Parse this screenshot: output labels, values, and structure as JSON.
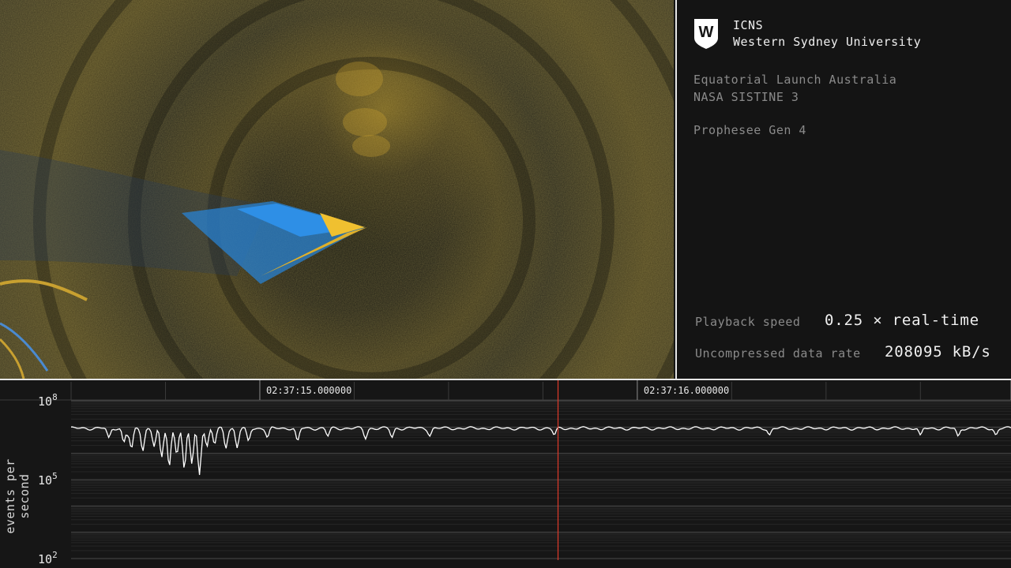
{
  "panel": {
    "logo_letter": "W",
    "org_line1": "ICNS",
    "org_line2": "Western Sydney University",
    "location": "Equatorial Launch Australia",
    "mission": "NASA SISTINE 3",
    "sensor": "Prophesee Gen 4",
    "playback_label": "Playback speed",
    "playback_value": "0.25 × real-time",
    "datarate_label": "Uncompressed data rate",
    "datarate_value": "208095 kB/s"
  },
  "chart_data": {
    "type": "line",
    "title": "",
    "ylabel": "events per second",
    "xlabel": "",
    "yscale": "log",
    "ylim": [
      100,
      100000000
    ],
    "y_ticks": [
      {
        "base": "10",
        "exp": "8",
        "value": 100000000
      },
      {
        "base": "10",
        "exp": "5",
        "value": 100000
      },
      {
        "base": "10",
        "exp": "2",
        "value": 100
      }
    ],
    "x_ticks": [
      "02:37:15.000000",
      "02:37:16.000000",
      "02:"
    ],
    "x_tick_seconds": [
      15.0,
      16.0,
      16.99
    ],
    "xlim_seconds": [
      14.5,
      16.99
    ],
    "cursor_seconds": 15.79,
    "colors": {
      "line": "#ffffff",
      "cursor": "#e03a2a",
      "grid": "#3a3a3a"
    },
    "baseline_events_per_second": 9000000,
    "dips": [
      {
        "t": 14.6,
        "v": 4000000
      },
      {
        "t": 14.65,
        "v": 5000000
      },
      {
        "t": 14.64,
        "v": 2500000
      },
      {
        "t": 14.66,
        "v": 1500000
      },
      {
        "t": 14.69,
        "v": 1200000
      },
      {
        "t": 14.72,
        "v": 1800000
      },
      {
        "t": 14.74,
        "v": 700000
      },
      {
        "t": 14.76,
        "v": 300000
      },
      {
        "t": 14.78,
        "v": 900000
      },
      {
        "t": 14.8,
        "v": 250000
      },
      {
        "t": 14.82,
        "v": 400000
      },
      {
        "t": 14.84,
        "v": 150000
      },
      {
        "t": 14.86,
        "v": 1800000
      },
      {
        "t": 14.88,
        "v": 2200000
      },
      {
        "t": 14.91,
        "v": 1500000
      },
      {
        "t": 14.94,
        "v": 1600000
      },
      {
        "t": 14.97,
        "v": 3000000
      },
      {
        "t": 15.02,
        "v": 4000000
      },
      {
        "t": 15.1,
        "v": 3000000
      },
      {
        "t": 15.18,
        "v": 4500000
      },
      {
        "t": 15.28,
        "v": 3500000
      },
      {
        "t": 15.35,
        "v": 4000000
      },
      {
        "t": 15.45,
        "v": 4500000
      },
      {
        "t": 15.78,
        "v": 5000000
      },
      {
        "t": 16.35,
        "v": 5000000
      },
      {
        "t": 16.75,
        "v": 5000000
      },
      {
        "t": 16.85,
        "v": 4500000
      },
      {
        "t": 16.95,
        "v": 5000000
      }
    ]
  }
}
